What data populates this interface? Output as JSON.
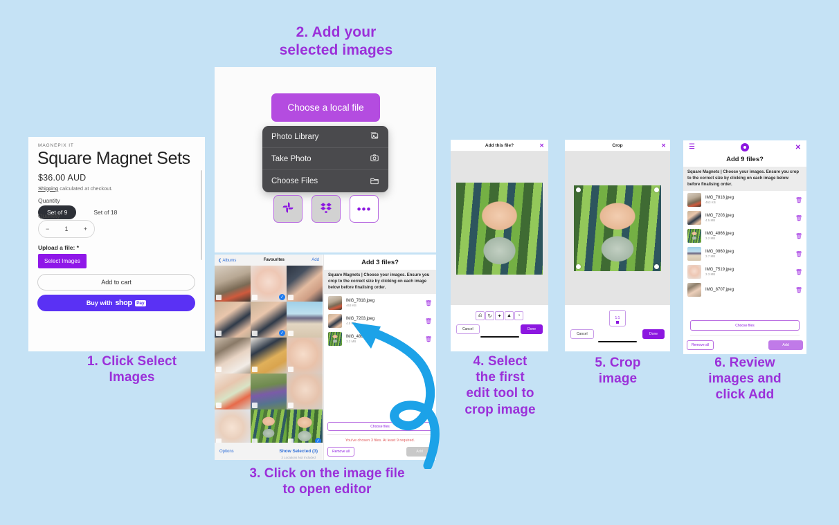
{
  "page": {
    "background": "#c5e2f5",
    "accent": "#8c17e0",
    "caption_color": "#9b30d9"
  },
  "captions": {
    "step1": "1.  Click Select\nImages",
    "step2": "2. Add your\nselected images",
    "step3": "3. Click on the image file\nto open editor",
    "step4": "4. Select\nthe first\nedit tool to\ncrop image",
    "step5": "5. Crop\nimage",
    "step6": "6. Review\nimages and\nclick Add"
  },
  "product": {
    "vendor": "MAGNEPIX IT",
    "title": "Square Magnet Sets",
    "price": "$36.00 AUD",
    "shipping_link": "Shipping",
    "shipping_rest": " calculated at checkout.",
    "quantity_label": "Quantity",
    "variants": [
      {
        "label": "Set of 9",
        "selected": true
      },
      {
        "label": "Set of 18",
        "selected": false
      }
    ],
    "quantity_label_2": "Quantity",
    "stepper": {
      "minus": "−",
      "value": "1",
      "plus": "+"
    },
    "upload_label": "Upload a file: *",
    "select_images_button": "Select Images",
    "add_to_cart_button": "Add to cart",
    "shop_pay_prefix": "Buy with",
    "shop_pay_logo": "shop",
    "shop_pay_badge": "Pay"
  },
  "uploader": {
    "choose_local_button": "Choose a local file",
    "menu": [
      {
        "label": "Photo Library",
        "icon": "photo-library-icon"
      },
      {
        "label": "Take Photo",
        "icon": "camera-icon"
      },
      {
        "label": "Choose Files",
        "icon": "folder-icon"
      }
    ],
    "sources": [
      {
        "icon": "google-photos-icon"
      },
      {
        "icon": "dropbox-icon"
      },
      {
        "icon": "more-icon",
        "label": "•••"
      }
    ]
  },
  "photo_picker": {
    "back_label": "Albums",
    "title": "Favourites",
    "add_label": "Add",
    "options_label": "Options",
    "show_selected_label": "Show Selected (3)",
    "show_selected_sub": "3 Locations Not Included",
    "grid": [
      {
        "photo": "p-flowers",
        "selected": false
      },
      {
        "photo": "p-babypink",
        "selected": true
      },
      {
        "photo": "p-twins-dark",
        "selected": false
      },
      {
        "photo": "p-twins-light",
        "selected": false
      },
      {
        "photo": "p-twins-light",
        "selected": true
      },
      {
        "photo": "p-beach",
        "selected": false
      },
      {
        "photo": "p-mum",
        "selected": false
      },
      {
        "photo": "p-twosit",
        "selected": false
      },
      {
        "photo": "p-closeup",
        "selected": false
      },
      {
        "photo": "p-toy",
        "selected": false
      },
      {
        "photo": "p-toddler",
        "selected": false
      },
      {
        "photo": "p-grey",
        "selected": false
      },
      {
        "photo": "p-blanket",
        "selected": false
      },
      {
        "photo": "baby-green",
        "selected": false
      },
      {
        "photo": "baby-hammock",
        "selected": true
      }
    ]
  },
  "dialog_3_files": {
    "title": "Add 3 files?",
    "note": "Square Magnets | Choose your images. Ensure you crop to the correct size by clicking on each image below before finalising order.",
    "files": [
      {
        "name": "IMG_7818.jpeg",
        "size": "463 KB",
        "photo": "p-flowers"
      },
      {
        "name": "IMG_7203.jpeg",
        "size": "4.5 MB",
        "photo": "p-twins-light"
      },
      {
        "name": "IMG_4866.jpeg",
        "size": "3.2 MB",
        "photo": "baby-green"
      }
    ],
    "choose_files_button": "Choose files",
    "warning": "You've chosen 3 files. At least 9 required.",
    "remove_all_button": "Remove all",
    "add_button": "Add"
  },
  "editor_add_file": {
    "title": "Add this file?",
    "close_icon": "close-icon",
    "tools": [
      {
        "icon": "crop-icon",
        "glyph": "⟲"
      },
      {
        "icon": "rotate-icon",
        "glyph": "↻"
      },
      {
        "icon": "magic-wand-icon",
        "glyph": "✦"
      },
      {
        "icon": "filter-icon",
        "glyph": "▲"
      },
      {
        "icon": "color-icon",
        "glyph": "◑"
      }
    ],
    "cancel_button": "Cancel",
    "done_button": "Done",
    "photo": "baby-hammock"
  },
  "editor_crop": {
    "title": "Crop",
    "close_icon": "close-icon",
    "ratio_label": "1:1",
    "cancel_button": "Cancel",
    "done_button": "Done",
    "photo": "baby-hammock"
  },
  "dialog_9_files": {
    "menu_icon": "hamburger-icon",
    "brand_icon": "brand-logo-icon",
    "close_icon": "close-icon",
    "title": "Add 9 files?",
    "note": "Square Magnets | Choose your images. Ensure you crop to the correct size by clicking on each image below before finalising order.",
    "files": [
      {
        "name": "IMG_7818.jpeg",
        "size": "463 KB",
        "photo": "p-flowers"
      },
      {
        "name": "IMG_7203.jpeg",
        "size": "4.5 MB",
        "photo": "p-twins-light"
      },
      {
        "name": "IMG_4866.jpeg",
        "size": "3.2 MB",
        "photo": "baby-green"
      },
      {
        "name": "IMG_0860.jpeg",
        "size": "3.7 MB",
        "photo": "p-beach"
      },
      {
        "name": "IMG_7519.jpeg",
        "size": "3.3 MB",
        "photo": "p-babypink"
      },
      {
        "name": "IMG_8707.jpeg",
        "size": "",
        "photo": "p-pair"
      }
    ],
    "choose_files_button": "Choose files",
    "remove_all_button": "Remove all",
    "add_button": "Add"
  }
}
